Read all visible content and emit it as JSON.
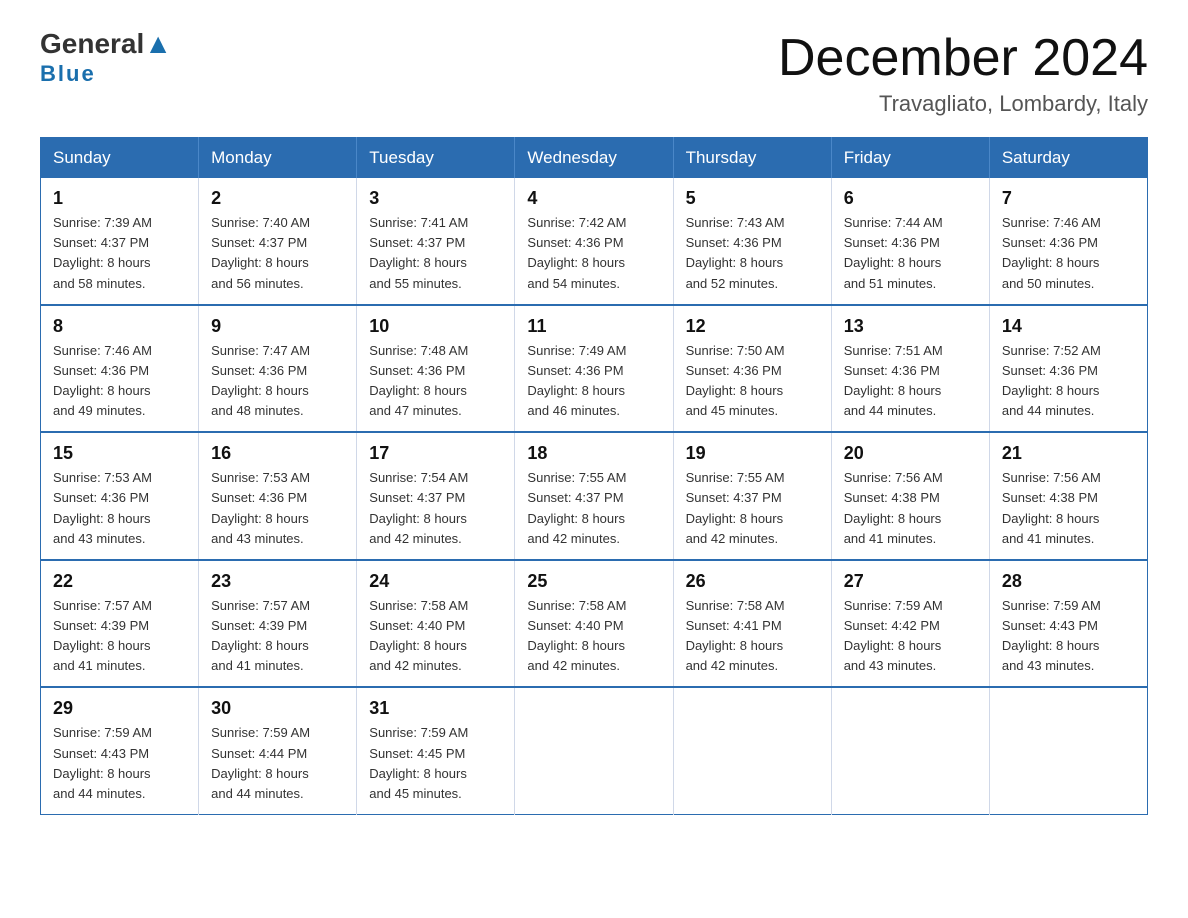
{
  "logo": {
    "general": "General",
    "triangle": "▲",
    "blue": "Blue"
  },
  "header": {
    "month": "December 2024",
    "location": "Travagliato, Lombardy, Italy"
  },
  "days_of_week": [
    "Sunday",
    "Monday",
    "Tuesday",
    "Wednesday",
    "Thursday",
    "Friday",
    "Saturday"
  ],
  "weeks": [
    [
      {
        "day": "1",
        "sunrise": "7:39 AM",
        "sunset": "4:37 PM",
        "daylight": "8 hours and 58 minutes."
      },
      {
        "day": "2",
        "sunrise": "7:40 AM",
        "sunset": "4:37 PM",
        "daylight": "8 hours and 56 minutes."
      },
      {
        "day": "3",
        "sunrise": "7:41 AM",
        "sunset": "4:37 PM",
        "daylight": "8 hours and 55 minutes."
      },
      {
        "day": "4",
        "sunrise": "7:42 AM",
        "sunset": "4:36 PM",
        "daylight": "8 hours and 54 minutes."
      },
      {
        "day": "5",
        "sunrise": "7:43 AM",
        "sunset": "4:36 PM",
        "daylight": "8 hours and 52 minutes."
      },
      {
        "day": "6",
        "sunrise": "7:44 AM",
        "sunset": "4:36 PM",
        "daylight": "8 hours and 51 minutes."
      },
      {
        "day": "7",
        "sunrise": "7:46 AM",
        "sunset": "4:36 PM",
        "daylight": "8 hours and 50 minutes."
      }
    ],
    [
      {
        "day": "8",
        "sunrise": "7:46 AM",
        "sunset": "4:36 PM",
        "daylight": "8 hours and 49 minutes."
      },
      {
        "day": "9",
        "sunrise": "7:47 AM",
        "sunset": "4:36 PM",
        "daylight": "8 hours and 48 minutes."
      },
      {
        "day": "10",
        "sunrise": "7:48 AM",
        "sunset": "4:36 PM",
        "daylight": "8 hours and 47 minutes."
      },
      {
        "day": "11",
        "sunrise": "7:49 AM",
        "sunset": "4:36 PM",
        "daylight": "8 hours and 46 minutes."
      },
      {
        "day": "12",
        "sunrise": "7:50 AM",
        "sunset": "4:36 PM",
        "daylight": "8 hours and 45 minutes."
      },
      {
        "day": "13",
        "sunrise": "7:51 AM",
        "sunset": "4:36 PM",
        "daylight": "8 hours and 44 minutes."
      },
      {
        "day": "14",
        "sunrise": "7:52 AM",
        "sunset": "4:36 PM",
        "daylight": "8 hours and 44 minutes."
      }
    ],
    [
      {
        "day": "15",
        "sunrise": "7:53 AM",
        "sunset": "4:36 PM",
        "daylight": "8 hours and 43 minutes."
      },
      {
        "day": "16",
        "sunrise": "7:53 AM",
        "sunset": "4:36 PM",
        "daylight": "8 hours and 43 minutes."
      },
      {
        "day": "17",
        "sunrise": "7:54 AM",
        "sunset": "4:37 PM",
        "daylight": "8 hours and 42 minutes."
      },
      {
        "day": "18",
        "sunrise": "7:55 AM",
        "sunset": "4:37 PM",
        "daylight": "8 hours and 42 minutes."
      },
      {
        "day": "19",
        "sunrise": "7:55 AM",
        "sunset": "4:37 PM",
        "daylight": "8 hours and 42 minutes."
      },
      {
        "day": "20",
        "sunrise": "7:56 AM",
        "sunset": "4:38 PM",
        "daylight": "8 hours and 41 minutes."
      },
      {
        "day": "21",
        "sunrise": "7:56 AM",
        "sunset": "4:38 PM",
        "daylight": "8 hours and 41 minutes."
      }
    ],
    [
      {
        "day": "22",
        "sunrise": "7:57 AM",
        "sunset": "4:39 PM",
        "daylight": "8 hours and 41 minutes."
      },
      {
        "day": "23",
        "sunrise": "7:57 AM",
        "sunset": "4:39 PM",
        "daylight": "8 hours and 41 minutes."
      },
      {
        "day": "24",
        "sunrise": "7:58 AM",
        "sunset": "4:40 PM",
        "daylight": "8 hours and 42 minutes."
      },
      {
        "day": "25",
        "sunrise": "7:58 AM",
        "sunset": "4:40 PM",
        "daylight": "8 hours and 42 minutes."
      },
      {
        "day": "26",
        "sunrise": "7:58 AM",
        "sunset": "4:41 PM",
        "daylight": "8 hours and 42 minutes."
      },
      {
        "day": "27",
        "sunrise": "7:59 AM",
        "sunset": "4:42 PM",
        "daylight": "8 hours and 43 minutes."
      },
      {
        "day": "28",
        "sunrise": "7:59 AM",
        "sunset": "4:43 PM",
        "daylight": "8 hours and 43 minutes."
      }
    ],
    [
      {
        "day": "29",
        "sunrise": "7:59 AM",
        "sunset": "4:43 PM",
        "daylight": "8 hours and 44 minutes."
      },
      {
        "day": "30",
        "sunrise": "7:59 AM",
        "sunset": "4:44 PM",
        "daylight": "8 hours and 44 minutes."
      },
      {
        "day": "31",
        "sunrise": "7:59 AM",
        "sunset": "4:45 PM",
        "daylight": "8 hours and 45 minutes."
      },
      null,
      null,
      null,
      null
    ]
  ],
  "labels": {
    "sunrise": "Sunrise:",
    "sunset": "Sunset:",
    "daylight": "Daylight:"
  }
}
